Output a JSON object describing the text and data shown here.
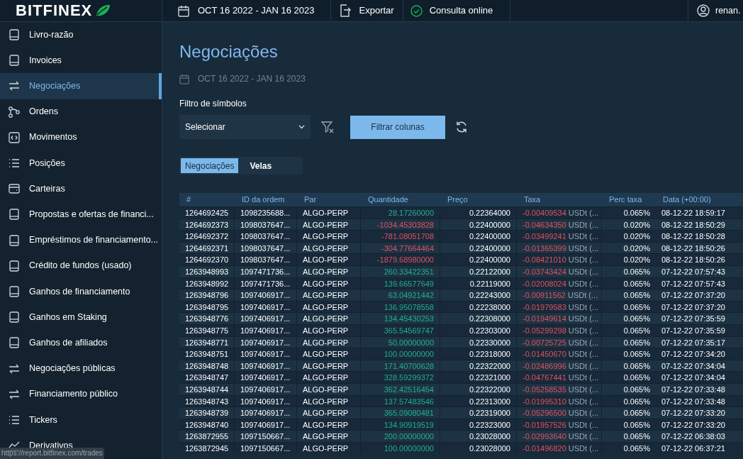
{
  "top_bar": {
    "logo": "BITFINEX",
    "date_range": "OCT 16 2022 - JAN 16 2023",
    "export": "Exportar",
    "status": "Consulta online",
    "user": "renan."
  },
  "sidebar": {
    "items": [
      {
        "label": "Livro-razão",
        "selected": false
      },
      {
        "label": "Invoices",
        "selected": false
      },
      {
        "label": "Negociações",
        "selected": true
      },
      {
        "label": "Ordens",
        "selected": false
      },
      {
        "label": "Movimentos",
        "selected": false
      },
      {
        "label": "Posições",
        "selected": false
      },
      {
        "label": "Carteiras",
        "selected": false
      },
      {
        "label": "Propostas e ofertas de financi...",
        "selected": false
      },
      {
        "label": "Empréstimos de financiamento...",
        "selected": false
      },
      {
        "label": "Crédito de fundos (usado)",
        "selected": false
      },
      {
        "label": "Ganhos de financiamento",
        "selected": false
      },
      {
        "label": "Ganhos em Staking",
        "selected": false
      },
      {
        "label": "Ganhos de afiliados",
        "selected": false
      },
      {
        "label": "Negociações públicas",
        "selected": false
      },
      {
        "label": "Financiamento público",
        "selected": false
      },
      {
        "label": "Tickers",
        "selected": false
      },
      {
        "label": "Derivativos",
        "selected": false
      }
    ]
  },
  "page": {
    "title": "Negociações",
    "date_range": "OCT 16 2022 - JAN 16 2023",
    "filter_label": "Filtro de símbolos",
    "symbol_select": "Selecionar",
    "filter_button": "Filtrar colunas",
    "tabs": [
      {
        "label": "Negociações",
        "selected": true
      },
      {
        "label": "Velas",
        "selected": false
      }
    ],
    "table": {
      "columns": [
        "#",
        "ID da ordem",
        "Par",
        "Quantidade",
        "Preço",
        "Taxa",
        "Perc taxa",
        "Data (+00:00)"
      ],
      "rows": [
        {
          "id": "1264692425",
          "order_id": "1098235688...",
          "pair": "ALGO-PERP",
          "amount": "28.17260000",
          "kind": "buy",
          "price": "0.22364000",
          "fee": "-0.00409534",
          "fee_unit": "USDt (...",
          "fee_pct": "0.065%",
          "date": "08-12-22 18:59:17"
        },
        {
          "id": "1264692373",
          "order_id": "1098037647...",
          "pair": "ALGO-PERP",
          "amount": "-1034.45303828",
          "kind": "sell",
          "price": "0.22400000",
          "fee": "-0.04634350",
          "fee_unit": "USDt (...",
          "fee_pct": "0.020%",
          "date": "08-12-22 18:50:29"
        },
        {
          "id": "1264692372",
          "order_id": "1098037647...",
          "pair": "ALGO-PERP",
          "amount": "-781.08051708",
          "kind": "sell",
          "price": "0.22400000",
          "fee": "-0.03499241",
          "fee_unit": "USDt (...",
          "fee_pct": "0.020%",
          "date": "08-12-22 18:50:28"
        },
        {
          "id": "1264692371",
          "order_id": "1098037647...",
          "pair": "ALGO-PERP",
          "amount": "-304.77664464",
          "kind": "sell",
          "price": "0.22400000",
          "fee": "-0.01365399",
          "fee_unit": "USDt (...",
          "fee_pct": "0.020%",
          "date": "08-12-22 18:50:26"
        },
        {
          "id": "1264692370",
          "order_id": "1098037647...",
          "pair": "ALGO-PERP",
          "amount": "-1879.68980000",
          "kind": "sell",
          "price": "0.22400000",
          "fee": "-0.08421010",
          "fee_unit": "USDt (...",
          "fee_pct": "0.020%",
          "date": "08-12-22 18:50:26"
        },
        {
          "id": "1263948993",
          "order_id": "1097471736...",
          "pair": "ALGO-PERP",
          "amount": "260.33422351",
          "kind": "buy",
          "price": "0.22122000",
          "fee": "-0.03743424",
          "fee_unit": "USDt (...",
          "fee_pct": "0.065%",
          "date": "07-12-22 07:57:43"
        },
        {
          "id": "1263948992",
          "order_id": "1097471736...",
          "pair": "ALGO-PERP",
          "amount": "139.66577649",
          "kind": "buy",
          "price": "0.22119000",
          "fee": "-0.02008024",
          "fee_unit": "USDt (...",
          "fee_pct": "0.065%",
          "date": "07-12-22 07:57:43"
        },
        {
          "id": "1263948796",
          "order_id": "1097406917...",
          "pair": "ALGO-PERP",
          "amount": "63.04921442",
          "kind": "buy",
          "price": "0.22243000",
          "fee": "-0.00911562",
          "fee_unit": "USDt (...",
          "fee_pct": "0.065%",
          "date": "07-12-22 07:37:20"
        },
        {
          "id": "1263948795",
          "order_id": "1097406917...",
          "pair": "ALGO-PERP",
          "amount": "136.95078558",
          "kind": "buy",
          "price": "0.22238000",
          "fee": "-0.01979583",
          "fee_unit": "USDt (...",
          "fee_pct": "0.065%",
          "date": "07-12-22 07:37:20"
        },
        {
          "id": "1263948776",
          "order_id": "1097406917...",
          "pair": "ALGO-PERP",
          "amount": "134.45430253",
          "kind": "buy",
          "price": "0.22308000",
          "fee": "-0.01949614",
          "fee_unit": "USDt (...",
          "fee_pct": "0.065%",
          "date": "07-12-22 07:35:59"
        },
        {
          "id": "1263948775",
          "order_id": "1097406917...",
          "pair": "ALGO-PERP",
          "amount": "365.54569747",
          "kind": "buy",
          "price": "0.22303000",
          "fee": "-0.05299298",
          "fee_unit": "USDt (...",
          "fee_pct": "0.065%",
          "date": "07-12-22 07:35:59"
        },
        {
          "id": "1263948771",
          "order_id": "1097406917...",
          "pair": "ALGO-PERP",
          "amount": "50.00000000",
          "kind": "buy",
          "price": "0.22330000",
          "fee": "-0.00725725",
          "fee_unit": "USDt (...",
          "fee_pct": "0.065%",
          "date": "07-12-22 07:35:17"
        },
        {
          "id": "1263948751",
          "order_id": "1097406917...",
          "pair": "ALGO-PERP",
          "amount": "100.00000000",
          "kind": "buy",
          "price": "0.22318000",
          "fee": "-0.01450670",
          "fee_unit": "USDt (...",
          "fee_pct": "0.065%",
          "date": "07-12-22 07:34:20"
        },
        {
          "id": "1263948748",
          "order_id": "1097406917...",
          "pair": "ALGO-PERP",
          "amount": "171.40700628",
          "kind": "buy",
          "price": "0.22322000",
          "fee": "-0.02486996",
          "fee_unit": "USDt (...",
          "fee_pct": "0.065%",
          "date": "07-12-22 07:34:04"
        },
        {
          "id": "1263948747",
          "order_id": "1097406917...",
          "pair": "ALGO-PERP",
          "amount": "328.59299372",
          "kind": "buy",
          "price": "0.22321000",
          "fee": "-0.04767441",
          "fee_unit": "USDt (...",
          "fee_pct": "0.065%",
          "date": "07-12-22 07:34:04"
        },
        {
          "id": "1263948744",
          "order_id": "1097406917...",
          "pair": "ALGO-PERP",
          "amount": "362.42516454",
          "kind": "buy",
          "price": "0.22322000",
          "fee": "-0.05258535",
          "fee_unit": "USDt (...",
          "fee_pct": "0.065%",
          "date": "07-12-22 07:33:48"
        },
        {
          "id": "1263948743",
          "order_id": "1097406917...",
          "pair": "ALGO-PERP",
          "amount": "137.57483546",
          "kind": "buy",
          "price": "0.22313000",
          "fee": "-0.01995310",
          "fee_unit": "USDt (...",
          "fee_pct": "0.065%",
          "date": "07-12-22 07:33:48"
        },
        {
          "id": "1263948739",
          "order_id": "1097406917...",
          "pair": "ALGO-PERP",
          "amount": "365.09080481",
          "kind": "buy",
          "price": "0.22319000",
          "fee": "-0.05296500",
          "fee_unit": "USDt (...",
          "fee_pct": "0.065%",
          "date": "07-12-22 07:33:20"
        },
        {
          "id": "1263948740",
          "order_id": "1097406917...",
          "pair": "ALGO-PERP",
          "amount": "134.90919519",
          "kind": "buy",
          "price": "0.22323000",
          "fee": "-0.01957526",
          "fee_unit": "USDt (...",
          "fee_pct": "0.065%",
          "date": "07-12-22 07:33:20"
        },
        {
          "id": "1263872955",
          "order_id": "1097150667...",
          "pair": "ALGO-PERP",
          "amount": "200.00000000",
          "kind": "buy",
          "price": "0.23028000",
          "fee": "-0.02993640",
          "fee_unit": "USDt (...",
          "fee_pct": "0.065%",
          "date": "07-12-22 06:38:03"
        },
        {
          "id": "1263872945",
          "order_id": "1097150667...",
          "pair": "ALGO-PERP",
          "amount": "100.00000000",
          "kind": "buy",
          "price": "0.23028000",
          "fee": "-0.01496820",
          "fee_unit": "USDt (...",
          "fee_pct": "0.065%",
          "date": "07-12-22 06:37:21"
        }
      ]
    }
  },
  "status_url": "https://report.bitfinex.com/trades"
}
